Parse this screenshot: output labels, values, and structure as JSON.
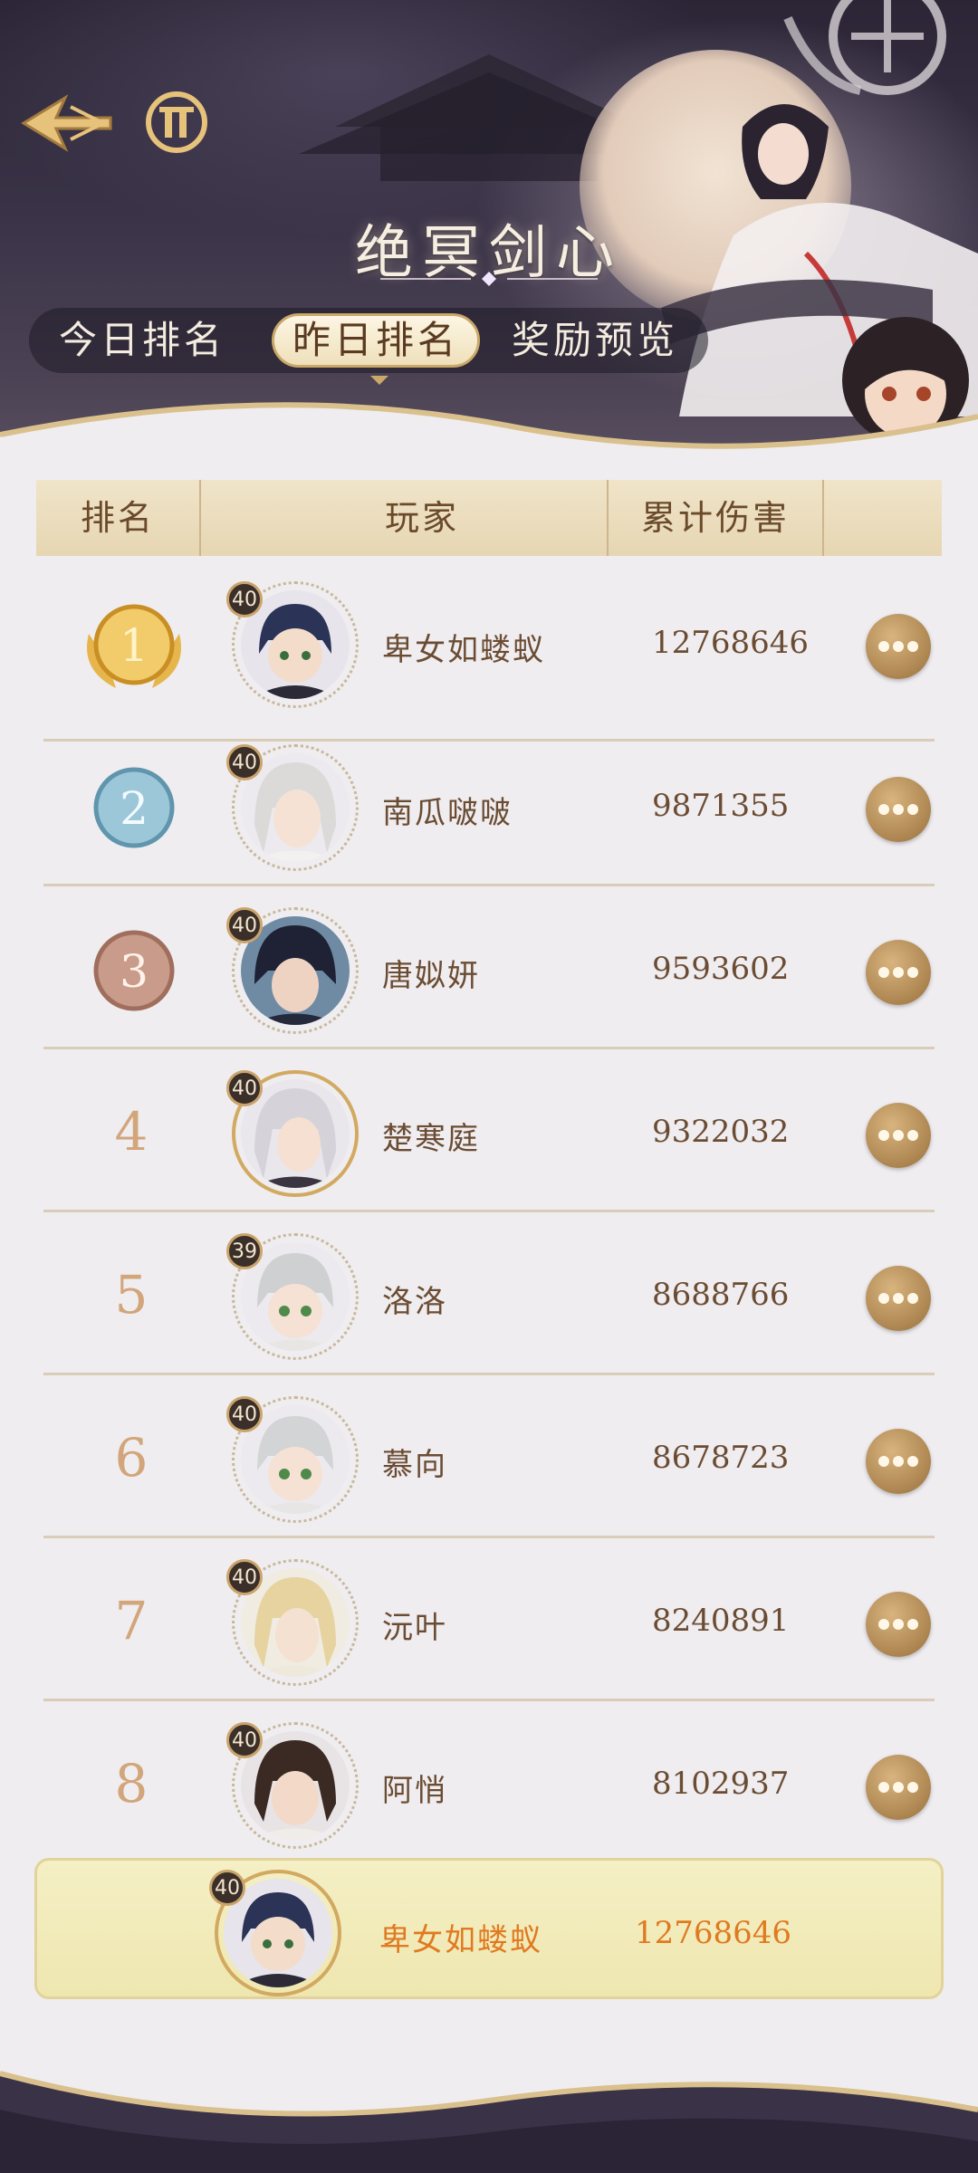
{
  "header": {
    "title": "绝冥剑心",
    "tabs": [
      {
        "label": "今日排名",
        "active": false
      },
      {
        "label": "昨日排名",
        "active": true
      },
      {
        "label": "奖励预览",
        "active": false
      }
    ]
  },
  "table": {
    "columns": [
      "排名",
      "玩家",
      "累计伤害",
      ""
    ]
  },
  "rows": [
    {
      "rank": "1",
      "level": "40",
      "name": "卑女如蝼蚁",
      "damage": "12768646"
    },
    {
      "rank": "2",
      "level": "40",
      "name": "南瓜啵啵",
      "damage": "9871355"
    },
    {
      "rank": "3",
      "level": "40",
      "name": "唐姒妍",
      "damage": "9593602"
    },
    {
      "rank": "4",
      "level": "40",
      "name": "楚寒庭",
      "damage": "9322032"
    },
    {
      "rank": "5",
      "level": "39",
      "name": "洛洛",
      "damage": "8688766"
    },
    {
      "rank": "6",
      "level": "40",
      "name": "慕向",
      "damage": "8678723"
    },
    {
      "rank": "7",
      "level": "40",
      "name": "沅叶",
      "damage": "8240891"
    },
    {
      "rank": "8",
      "level": "40",
      "name": "阿悄",
      "damage": "8102937"
    }
  ],
  "self": {
    "level": "40",
    "name": "卑女如蝼蚁",
    "damage": "12768646"
  },
  "colors": {
    "accent_gold": "#caa46b",
    "self_highlight": "#e07a20",
    "rank_text": "#d2a57a"
  },
  "icons": [
    "back-arrow-icon",
    "menu-icon",
    "more-options-icon",
    "gold-medal-icon",
    "silver-medal-icon",
    "bronze-medal-icon"
  ]
}
